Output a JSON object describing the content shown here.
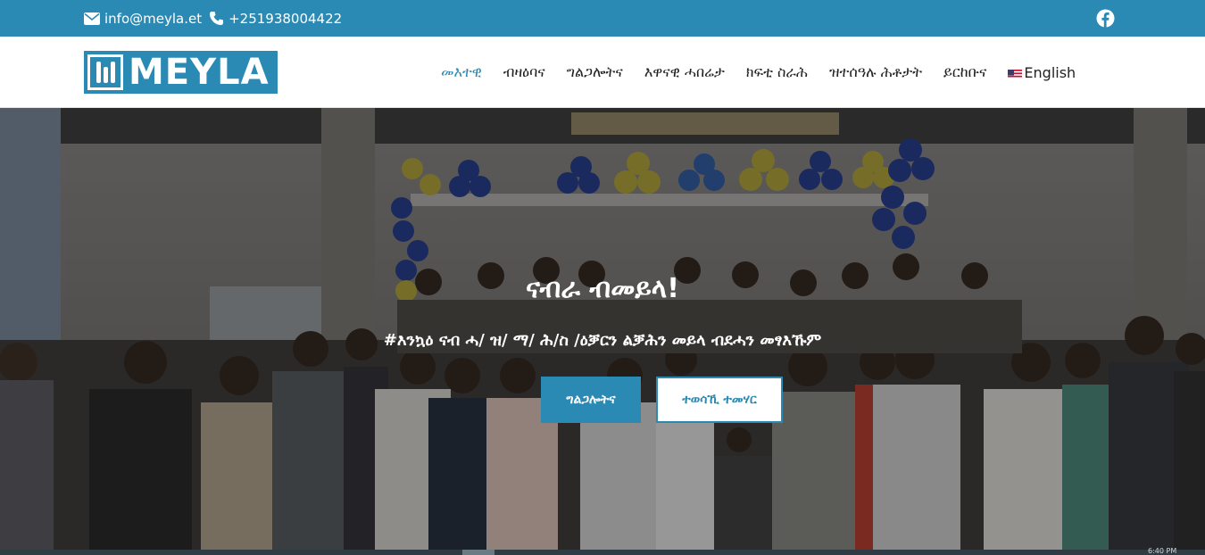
{
  "topbar": {
    "email": "info@meyla.et",
    "phone": "+251938004422",
    "email_icon": "envelope-icon",
    "phone_icon": "phone-icon",
    "social_icon": "facebook-icon",
    "background": "#2b8ab3"
  },
  "header": {
    "logo_text": "MEYLA",
    "nav": [
      {
        "label": "መእተዊ",
        "active": true
      },
      {
        "label": "ብዛዕባና",
        "active": false
      },
      {
        "label": "ግልጋሎትና",
        "active": false
      },
      {
        "label": "እዋናዊ ሓበሬታ",
        "active": false
      },
      {
        "label": "ክፍቲ ስራሕ",
        "active": false
      },
      {
        "label": "ዝተሰዓሉ ሕቶታት",
        "active": false
      },
      {
        "label": "ይርከቡና",
        "active": false
      }
    ],
    "language": "English",
    "language_icon": "us-flag-icon"
  },
  "hero": {
    "title": "ናብራ ብመይላ!",
    "subtitle": "#እንኳዕ ናብ ሓ/ ዝ/ ማ/ ሕ/ስ /ዕቓርን ልቓሕን መይላ ብደሓን መፃእኹም",
    "primary_button": "ግልጋሎትና",
    "secondary_button": "ተወሳኺ ተመሃር",
    "accent": "#2b8ab3"
  },
  "taskbar": {
    "clock": "6:40 PM"
  }
}
